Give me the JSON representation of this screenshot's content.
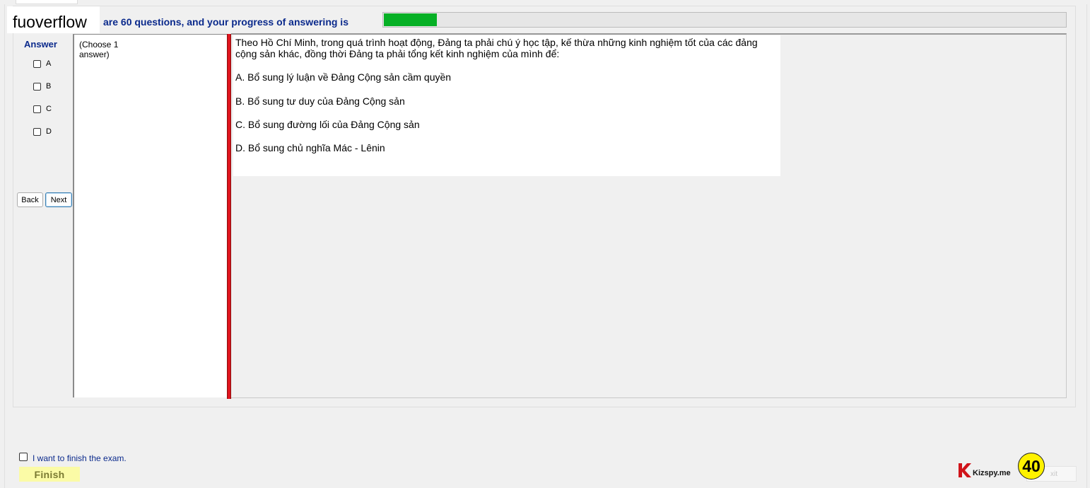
{
  "header": {
    "watermark": "fuoverflow",
    "progress_text": "are 60 questions, and your progress of answering is",
    "progress_fraction": 0.078
  },
  "answer_panel": {
    "title": "Answer",
    "options": [
      "A",
      "B",
      "C",
      "D"
    ],
    "back_label": "Back",
    "next_label": "Next"
  },
  "choose_hint": "(Choose 1 answer)",
  "question": {
    "stem": "Theo Hồ Chí Minh, trong quá trình hoạt động, Đảng ta phải chú ý học tập, kế thừa những kinh nghiệm tốt của các đảng cộng sản khác, đồng thời Đảng ta phải tổng kết kinh nghiệm của mình để:",
    "options": [
      "A.  Bổ sung lý luận về Đảng Cộng sản cầm quyền",
      "B.  Bổ sung tư duy của Đảng Cộng sản",
      "C.  Bổ sung đường lối của Đảng Cộng sản",
      "D.  Bổ sung chủ nghĩa Mác - Lênin"
    ]
  },
  "footer": {
    "finish_check_label": "I want to finish the exam.",
    "finish_label": "Finish",
    "exit_label": "xit",
    "brand_text": "Kizspy.me",
    "timer_value": "40"
  },
  "colors": {
    "progress_fill": "#06b025",
    "accent_text": "#0b2a8c",
    "divider": "#e0141e",
    "finish_bg": "#fbfba6",
    "timer_bg": "#fff200"
  }
}
